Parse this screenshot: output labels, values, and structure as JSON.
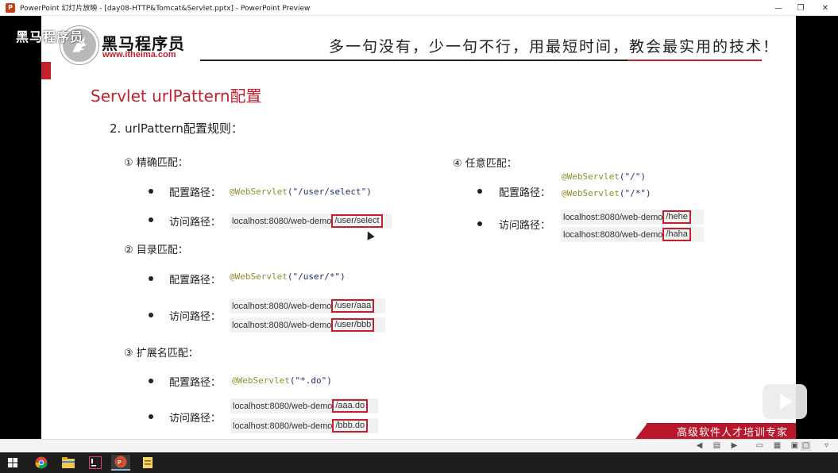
{
  "window": {
    "title": "PowerPoint 幻灯片放映 - [day08-HTTP&Tomcat&Servlet.pptx] - PowerPoint Preview",
    "app_icon": "P",
    "controls": [
      "minimize-icon",
      "restore-icon",
      "close-icon"
    ]
  },
  "overlay": {
    "watermark": "黑马程序员"
  },
  "slide": {
    "logo": {
      "name": "黑马程序员",
      "url": "www.itheima.com"
    },
    "slogan": "多一句没有，少一句不行，用最短时间，教会最实用的技术！",
    "title": "Servlet urlPattern配置",
    "section": "2. urlPattern配置规则：",
    "rules": {
      "exact": {
        "heading": "① 精确匹配：",
        "config_label": "配置路径：",
        "config_anno": "@WebServlet",
        "config_args": "(\"/user/select\")",
        "access_label": "访问路径：",
        "urls": [
          {
            "base": "localhost:8080/web-demo",
            "path": "/user/select"
          }
        ]
      },
      "dir": {
        "heading": "② 目录匹配：",
        "config_label": "配置路径：",
        "config_anno": "@WebServlet",
        "config_args": "(\"/user/*\")",
        "access_label": "访问路径：",
        "urls": [
          {
            "base": "localhost:8080/web-demo",
            "path": "/user/aaa"
          },
          {
            "base": "localhost:8080/web-demo",
            "path": "/user/bbb"
          }
        ]
      },
      "ext": {
        "heading": "③ 扩展名匹配：",
        "config_label": "配置路径：",
        "config_anno": "@WebServlet",
        "config_args": "(\"*.do\")",
        "access_label": "访问路径：",
        "urls": [
          {
            "base": "localhost:8080/web-demo",
            "path": "/aaa.do"
          },
          {
            "base": "localhost:8080/web-demo",
            "path": "/bbb.do"
          }
        ]
      },
      "any": {
        "heading": "④ 任意匹配：",
        "config_label": "配置路径：",
        "config_lines": [
          {
            "anno": "@WebServlet",
            "args": "(\"/\")"
          },
          {
            "anno": "@WebServlet",
            "args": "(\"/*\")"
          }
        ],
        "access_label": "访问路径：",
        "urls": [
          {
            "base": "localhost:8080/web-demo",
            "path": "/hehe"
          },
          {
            "base": "localhost:8080/web-demo",
            "path": "/haha"
          }
        ]
      }
    },
    "banner": "高级软件人才培训专家"
  },
  "statusbar": {
    "icons": [
      "prev-slide-icon",
      "menu-icon",
      "next-slide-icon",
      "reading-view-icon",
      "slide-sorter-icon",
      "normal-view-icon",
      "presenter-icon",
      "settings-icon"
    ]
  },
  "taskbar": {
    "icons": [
      "windows-start-icon",
      "chrome-icon",
      "file-explorer-icon",
      "intellij-icon",
      "powerpoint-icon",
      "notes-icon"
    ]
  }
}
